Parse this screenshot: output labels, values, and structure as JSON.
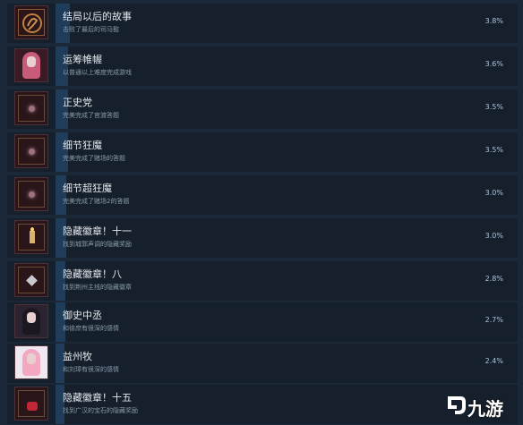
{
  "achievements": [
    {
      "title": "结局以后的故事",
      "desc": "击败了最后的司马懿",
      "percent": "3.8%",
      "percent_value": 3.8,
      "icon": "dragon-emblem-icon"
    },
    {
      "title": "运筹帷幄",
      "desc": "以普通以上难度完成游戏",
      "percent": "3.6%",
      "percent_value": 3.6,
      "icon": "pink-hair-portrait-icon"
    },
    {
      "title": "正史党",
      "desc": "完美完成了官渡答题",
      "percent": "3.5%",
      "percent_value": 3.5,
      "icon": "gem-frame-icon"
    },
    {
      "title": "细节狂魔",
      "desc": "完美完成了赌场的答题",
      "percent": "3.5%",
      "percent_value": 3.5,
      "icon": "gem-frame-icon"
    },
    {
      "title": "细节超狂魔",
      "desc": "完美完成了赌场2的答题",
      "percent": "3.0%",
      "percent_value": 3.0,
      "icon": "gem-frame-icon"
    },
    {
      "title": "隐藏徽章！十一",
      "desc": "找到城郭声调的隐藏奖励",
      "percent": "3.0%",
      "percent_value": 3.0,
      "icon": "candle-frame-icon"
    },
    {
      "title": "隐藏徽章！八",
      "desc": "找到荆州主线的隐藏徽章",
      "percent": "2.8%",
      "percent_value": 2.8,
      "icon": "crystal-frame-icon"
    },
    {
      "title": "御史中丞",
      "desc": "和徐庶有很深的感情",
      "percent": "2.7%",
      "percent_value": 2.7,
      "icon": "dark-hair-portrait-icon"
    },
    {
      "title": "益州牧",
      "desc": "和刘璋有很深的感情",
      "percent": "2.4%",
      "percent_value": 2.4,
      "icon": "pink-hair-girl-portrait-icon"
    },
    {
      "title": "隐藏徽章！十五",
      "desc": "找到广汉的宝石的隐藏奖励",
      "percent": "",
      "percent_value": null,
      "icon": "red-gem-frame-icon"
    }
  ],
  "watermark": {
    "text": "九游",
    "icon": "jiuyou-logo-icon"
  }
}
